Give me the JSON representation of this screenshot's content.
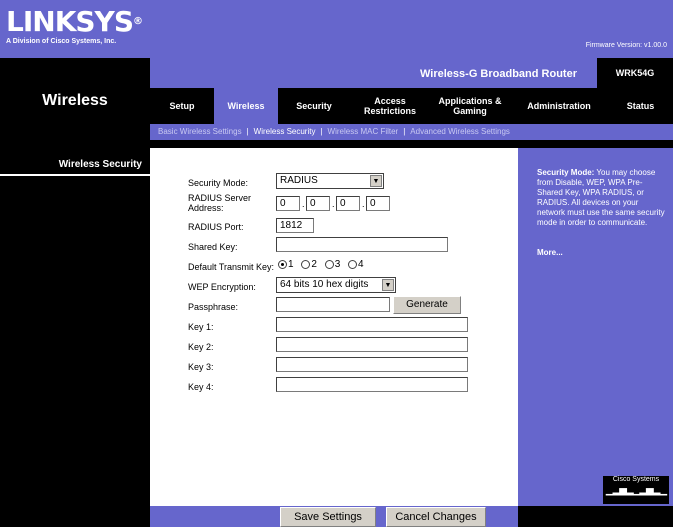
{
  "header": {
    "logo": "LINKSYS",
    "logo_registered": "®",
    "logo_sub": "A Division of Cisco Systems, Inc.",
    "firmware": "Firmware Version: v1.00.0",
    "product_name": "Wireless-G Broadband Router",
    "model": "WRK54G"
  },
  "section_title": "Wireless",
  "tabs": [
    {
      "label": "Setup"
    },
    {
      "label": "Wireless"
    },
    {
      "label": "Security"
    },
    {
      "label": "Access Restrictions"
    },
    {
      "label": "Applications & Gaming"
    },
    {
      "label": "Administration"
    },
    {
      "label": "Status"
    }
  ],
  "subtabs": [
    {
      "label": "Basic Wireless Settings"
    },
    {
      "label": "Wireless Security"
    },
    {
      "label": "Wireless MAC Filter"
    },
    {
      "label": "Advanced Wireless Settings"
    }
  ],
  "subtab_separator": "|",
  "left_heading": "Wireless Security",
  "form": {
    "security_mode_label": "Security Mode:",
    "security_mode_value": "RADIUS",
    "radius_server_label": "RADIUS Server Address:",
    "radius_ip": [
      "0",
      "0",
      "0",
      "0"
    ],
    "ip_dot": ".",
    "radius_port_label": "RADIUS Port:",
    "radius_port_value": "1812",
    "shared_key_label": "Shared Key:",
    "shared_key_value": "",
    "default_tx_key_label": "Default Transmit Key:",
    "tx_key_options": [
      "1",
      "2",
      "3",
      "4"
    ],
    "tx_key_selected": "1",
    "wep_label": "WEP Encryption:",
    "wep_value": "64 bits 10 hex digits",
    "passphrase_label": "Passphrase:",
    "passphrase_value": "",
    "generate_label": "Generate",
    "key1_label": "Key 1:",
    "key2_label": "Key 2:",
    "key3_label": "Key 3:",
    "key4_label": "Key 4:",
    "key_values": [
      "",
      "",
      "",
      ""
    ]
  },
  "help": {
    "heading": "Security Mode:",
    "text": "You may choose from Disable, WEP, WPA Pre-Shared Key, WPA RADIUS, or RADIUS. All devices on your network must use the same security mode in order to communicate.",
    "more": "More..."
  },
  "cisco_logo": "Cisco Systems",
  "footer": {
    "save": "Save Settings",
    "cancel": "Cancel Changes"
  },
  "colors": {
    "brand_purple": "#6666cc",
    "band_black": "#000000"
  }
}
